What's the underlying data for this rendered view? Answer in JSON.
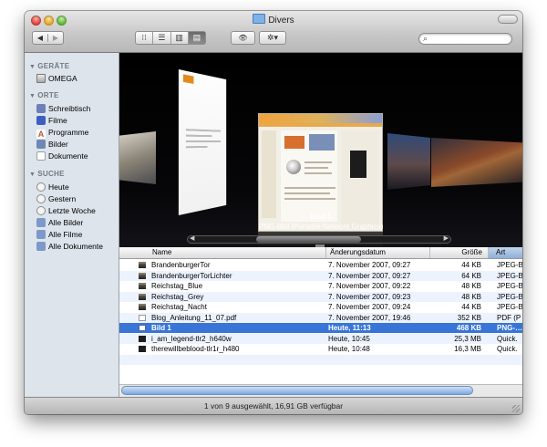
{
  "window": {
    "title": "Divers"
  },
  "toolbar": {
    "back_glyph": "◀",
    "forward_glyph": "▶",
    "view_icons": [
      "⁝⁝",
      "☰",
      "▥",
      "▤"
    ],
    "quicklook_glyph": "👁",
    "action_glyph": "✲▾",
    "search_value": ""
  },
  "sidebar": {
    "sections": [
      {
        "label": "GERÄTE",
        "items": [
          {
            "label": "OMEGA",
            "icon": "drive-icon"
          }
        ]
      },
      {
        "label": "ORTE",
        "items": [
          {
            "label": "Schreibtisch",
            "icon": "desktop-icon"
          },
          {
            "label": "Filme",
            "icon": "movies-icon"
          },
          {
            "label": "Programme",
            "icon": "applications-icon"
          },
          {
            "label": "Bilder",
            "icon": "pictures-icon"
          },
          {
            "label": "Dokumente",
            "icon": "documents-icon"
          }
        ]
      },
      {
        "label": "SUCHE",
        "items": [
          {
            "label": "Heute",
            "icon": "clock-icon"
          },
          {
            "label": "Gestern",
            "icon": "clock-icon"
          },
          {
            "label": "Letzte Woche",
            "icon": "clock-icon"
          },
          {
            "label": "Alle Bilder",
            "icon": "smart-folder-icon"
          },
          {
            "label": "Alle Filme",
            "icon": "smart-folder-icon"
          },
          {
            "label": "Alle Dokumente",
            "icon": "smart-folder-icon"
          }
        ]
      }
    ]
  },
  "coverflow": {
    "title": "Bild 1",
    "subtitle": "PNG-Bild (Portable Network Graphics)",
    "scroll_fraction": 0.55
  },
  "list": {
    "columns": [
      "Name",
      "Änderungsdatum",
      "Größe",
      "Art"
    ],
    "sorted_column": "Art",
    "rows": [
      {
        "name": "BrandenburgerTor",
        "date": "7. November 2007, 09:27",
        "size": "44 KB",
        "kind": "JPEG-B",
        "icon": "jpg"
      },
      {
        "name": "BrandenburgerTorLichter",
        "date": "7. November 2007, 09:27",
        "size": "64 KB",
        "kind": "JPEG-B",
        "icon": "jpg"
      },
      {
        "name": "Reichstag_Blue",
        "date": "7. November 2007, 09:22",
        "size": "48 KB",
        "kind": "JPEG-B",
        "icon": "jpg"
      },
      {
        "name": "Reichstag_Grey",
        "date": "7. November 2007, 09:23",
        "size": "48 KB",
        "kind": "JPEG-B",
        "icon": "jpg"
      },
      {
        "name": "Reichstag_Nacht",
        "date": "7. November 2007, 09:24",
        "size": "44 KB",
        "kind": "JPEG-B",
        "icon": "jpg"
      },
      {
        "name": "Blog_Anleitung_11_07.pdf",
        "date": "7. November 2007, 19:46",
        "size": "352 KB",
        "kind": "PDF (P",
        "icon": "pdf"
      },
      {
        "name": "Bild 1",
        "date": "Heute, 11:13",
        "size": "468 KB",
        "kind": "PNG-…",
        "icon": "png",
        "selected": true
      },
      {
        "name": "i_am_legend-tlr2_h640w",
        "date": "Heute, 10:45",
        "size": "25,3 MB",
        "kind": "Quick.",
        "icon": "mov"
      },
      {
        "name": "therewillbeblood-tlr1r_h480",
        "date": "Heute, 10:48",
        "size": "16,3 MB",
        "kind": "Quick.",
        "icon": "mov"
      }
    ]
  },
  "status": {
    "text": "1 von 9 ausgewählt, 16,91 GB verfügbar"
  },
  "colors": {
    "selection": "#3875d7",
    "sidebar_bg": "#dde4eb",
    "coverflow_bg": "#000000"
  }
}
